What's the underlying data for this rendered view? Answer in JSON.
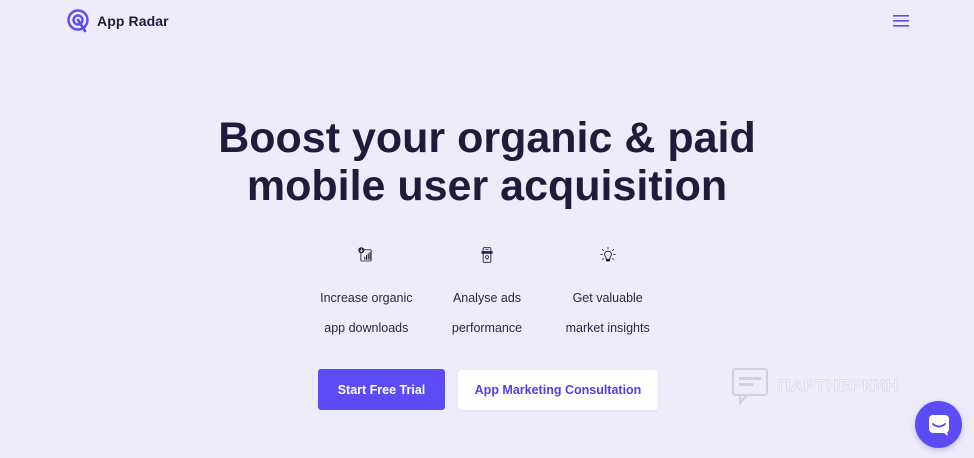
{
  "header": {
    "logo_text": "App Radar",
    "menu_icon": "hamburger-menu-icon"
  },
  "hero": {
    "headline_line1": "Boost your organic & paid",
    "headline_line2": "mobile user acquisition"
  },
  "features": [
    {
      "icon": "download-chart-icon",
      "label_line1": "Increase organic",
      "label_line2": "app downloads"
    },
    {
      "icon": "phone-ad-icon",
      "label_line1": "Analyse ads",
      "label_line2": "performance"
    },
    {
      "icon": "lightbulb-icon",
      "label_line1": "Get valuable",
      "label_line2": "market insights"
    }
  ],
  "cta": {
    "primary_label": "Start Free Trial",
    "secondary_label": "App Marketing Consultation"
  },
  "watermark": {
    "text": "ПАРТНЕРКИН"
  },
  "chat": {
    "icon": "chat-bubble-icon"
  },
  "colors": {
    "background": "#eeecfb",
    "text": "#1f1b3a",
    "accent": "#5b4cf5",
    "secondary_button_bg": "#ffffff"
  }
}
